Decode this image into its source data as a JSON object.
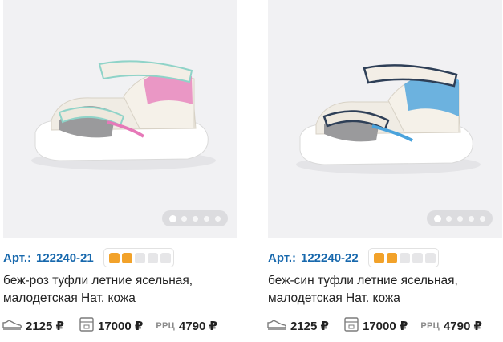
{
  "products": [
    {
      "art_label": "Арт.:",
      "art_number": "122240-21",
      "rating_filled": 2,
      "rating_total": 5,
      "name": "беж-роз туфли летние ясельная, малодетская Нат. кожа",
      "pair_price": "2125 ₽",
      "box_price": "17000 ₽",
      "rrc_label": "РРЦ",
      "rrc_price": "4790 ₽",
      "accent_color": "#e678b8",
      "image_dots": 5,
      "active_dot": 0
    },
    {
      "art_label": "Арт.:",
      "art_number": "122240-22",
      "rating_filled": 2,
      "rating_total": 5,
      "name": "беж-син туфли летние ясельная, малодетская Нат. кожа",
      "pair_price": "2125 ₽",
      "box_price": "17000 ₽",
      "rrc_label": "РРЦ",
      "rrc_price": "4790 ₽",
      "accent_color": "#4aa3dc",
      "image_dots": 5,
      "active_dot": 0
    }
  ],
  "icons": {
    "pair": "shoe-icon",
    "box": "box-icon"
  },
  "colors": {
    "link": "#1768ad",
    "rating_on": "#f2a22a",
    "rating_off": "#e6e6e8"
  }
}
